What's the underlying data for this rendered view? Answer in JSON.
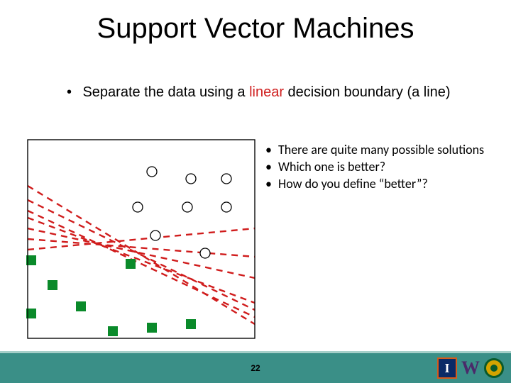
{
  "title": "Support Vector Machines",
  "bullet1_pre": "Separate the data using a ",
  "bullet1_linear": "linear",
  "bullet1_post": " decision boundary (a line)",
  "side": [
    "There are quite many possible solutions",
    "Which one is better?",
    "How do you define “better”?"
  ],
  "page_number": "22",
  "logo_i": "I",
  "logo_w": "W",
  "chart_data": {
    "type": "scatter",
    "title": "",
    "xlabel": "",
    "ylabel": "",
    "xlim": [
      0,
      320
    ],
    "ylim": [
      0,
      280
    ],
    "series": [
      {
        "name": "open-circle",
        "marker": "circle-open",
        "color": "#000000",
        "points": [
          [
            175,
            45
          ],
          [
            230,
            55
          ],
          [
            280,
            55
          ],
          [
            155,
            95
          ],
          [
            225,
            95
          ],
          [
            280,
            95
          ],
          [
            180,
            135
          ],
          [
            250,
            160
          ]
        ]
      },
      {
        "name": "filled-square",
        "marker": "square-filled",
        "color": "#0a8a2a",
        "points": [
          [
            5,
            170
          ],
          [
            35,
            205
          ],
          [
            5,
            245
          ],
          [
            75,
            235
          ],
          [
            120,
            270
          ],
          [
            145,
            175
          ],
          [
            175,
            265
          ],
          [
            230,
            260
          ]
        ]
      }
    ],
    "boundary_lines": [
      {
        "x1": 0,
        "y1": 65,
        "x2": 320,
        "y2": 260
      },
      {
        "x1": 0,
        "y1": 85,
        "x2": 320,
        "y2": 240
      },
      {
        "x1": 0,
        "y1": 100,
        "x2": 320,
        "y2": 250
      },
      {
        "x1": 0,
        "y1": 110,
        "x2": 320,
        "y2": 230
      },
      {
        "x1": 0,
        "y1": 125,
        "x2": 320,
        "y2": 195
      },
      {
        "x1": 0,
        "y1": 140,
        "x2": 320,
        "y2": 165
      },
      {
        "x1": 0,
        "y1": 155,
        "x2": 320,
        "y2": 125
      }
    ]
  }
}
